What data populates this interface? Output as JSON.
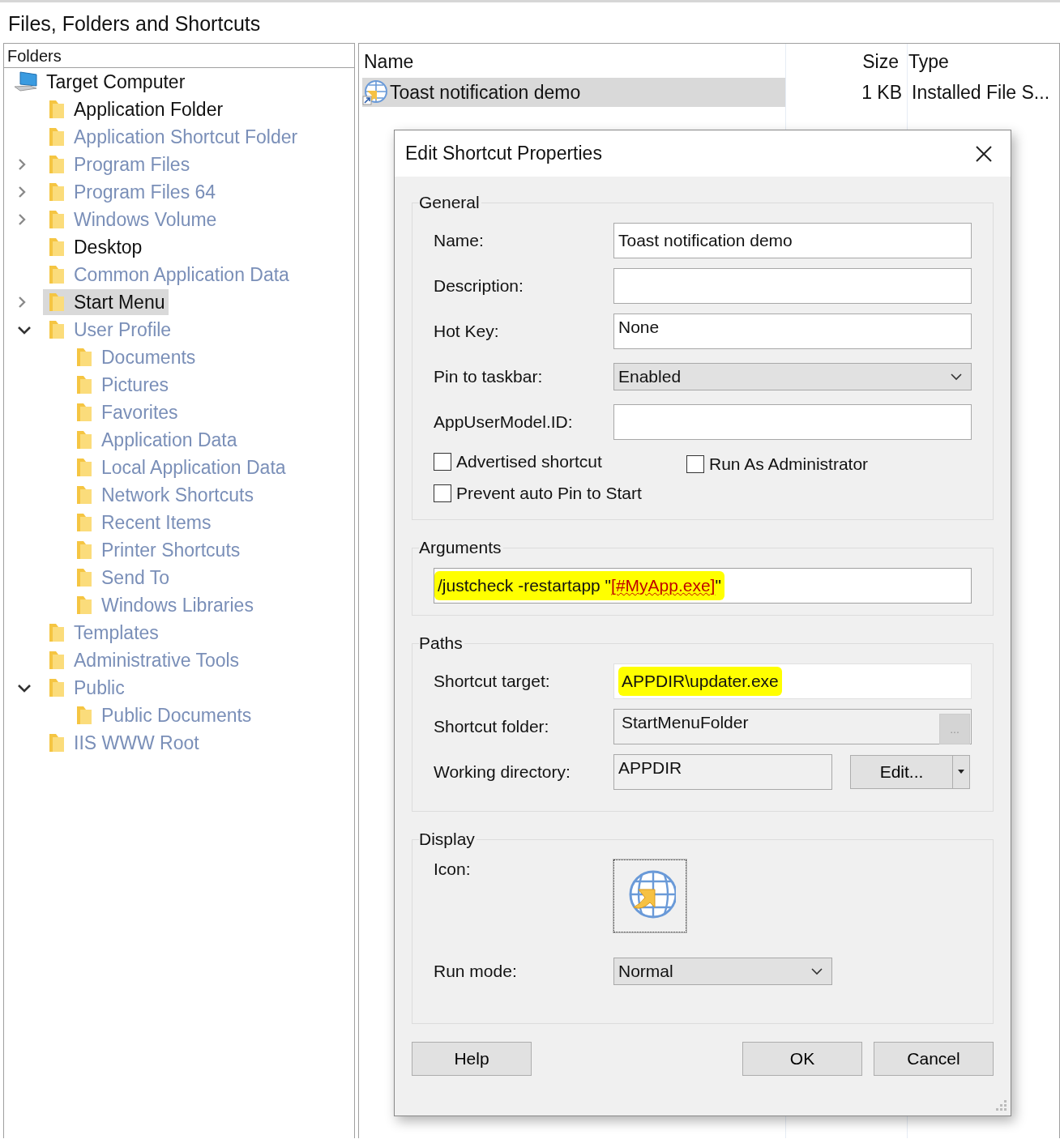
{
  "page": {
    "title": "Files, Folders and Shortcuts"
  },
  "folders_pane": {
    "header": "Folders",
    "tree": [
      {
        "label": "Target Computer",
        "kind": "root",
        "active": true,
        "selected": false,
        "children": [
          {
            "label": "Application Folder",
            "kind": "leaf",
            "active": true,
            "selected": false
          },
          {
            "label": "Application Shortcut Folder",
            "kind": "leaf",
            "active": false,
            "selected": false
          },
          {
            "label": "Program Files",
            "kind": "collapsed",
            "active": false,
            "selected": false
          },
          {
            "label": "Program Files 64",
            "kind": "collapsed",
            "active": false,
            "selected": false
          },
          {
            "label": "Windows Volume",
            "kind": "collapsed",
            "active": false,
            "selected": false
          },
          {
            "label": "Desktop",
            "kind": "leaf",
            "active": true,
            "selected": false
          },
          {
            "label": "Common Application Data",
            "kind": "leaf",
            "active": false,
            "selected": false
          },
          {
            "label": "Start Menu",
            "kind": "collapsed",
            "active": true,
            "selected": true
          },
          {
            "label": "User Profile",
            "kind": "expanded",
            "active": false,
            "selected": false,
            "children": [
              {
                "label": "Documents",
                "kind": "leaf",
                "active": false,
                "selected": false
              },
              {
                "label": "Pictures",
                "kind": "leaf",
                "active": false,
                "selected": false
              },
              {
                "label": "Favorites",
                "kind": "leaf",
                "active": false,
                "selected": false
              },
              {
                "label": "Application Data",
                "kind": "leaf",
                "active": false,
                "selected": false
              },
              {
                "label": "Local Application Data",
                "kind": "leaf",
                "active": false,
                "selected": false
              },
              {
                "label": "Network Shortcuts",
                "kind": "leaf",
                "active": false,
                "selected": false
              },
              {
                "label": "Recent Items",
                "kind": "leaf",
                "active": false,
                "selected": false
              },
              {
                "label": "Printer Shortcuts",
                "kind": "leaf",
                "active": false,
                "selected": false
              },
              {
                "label": "Send To",
                "kind": "leaf",
                "active": false,
                "selected": false
              },
              {
                "label": "Windows Libraries",
                "kind": "leaf",
                "active": false,
                "selected": false
              }
            ]
          },
          {
            "label": "Templates",
            "kind": "leaf",
            "active": false,
            "selected": false
          },
          {
            "label": "Administrative Tools",
            "kind": "leaf",
            "active": false,
            "selected": false
          },
          {
            "label": "Public",
            "kind": "expanded",
            "active": false,
            "selected": false,
            "children": [
              {
                "label": "Public Documents",
                "kind": "leaf",
                "active": false,
                "selected": false
              }
            ]
          },
          {
            "label": "IIS WWW Root",
            "kind": "leaf",
            "active": false,
            "selected": false
          }
        ]
      }
    ]
  },
  "files_pane": {
    "columns": [
      "Name",
      "Size",
      "Type"
    ],
    "rows": [
      {
        "name": "Toast notification demo",
        "size": "1 KB",
        "type": "Installed File S...",
        "selected": true
      }
    ]
  },
  "dialog": {
    "title": "Edit Shortcut Properties",
    "general": {
      "title": "General",
      "fields": [
        {
          "label": "Name:",
          "kind": "text",
          "value": "Toast notification demo"
        },
        {
          "label": "Description:",
          "kind": "text"
        },
        {
          "label": "Hot Key:",
          "kind": "hotkey",
          "value": "None"
        },
        {
          "label": "Pin to taskbar:",
          "kind": "dropdown",
          "value": "Enabled"
        },
        {
          "label": "AppUserModel.ID:",
          "kind": "text"
        }
      ],
      "checkboxes": [
        {
          "label": "Advertised shortcut",
          "checked": false
        },
        {
          "label": "Run As Administrator",
          "checked": false
        },
        {
          "label": "Prevent auto Pin to Start",
          "checked": false
        }
      ]
    },
    "arguments": {
      "title": "Arguments",
      "highlighted": true,
      "segments": [
        {
          "text": "/justcheck -restartapp \"",
          "kind": "plain"
        },
        {
          "text": "[#MyApp.exe]",
          "kind": "reference"
        },
        {
          "text": "\"",
          "kind": "plain"
        }
      ]
    },
    "paths": {
      "title": "Paths",
      "target": {
        "label": "Shortcut target:",
        "value": "APPDIR\\updater.exe",
        "highlighted": true
      },
      "folder": {
        "label": "Shortcut folder:",
        "value": "StartMenuFolder",
        "browse": "..."
      },
      "working": {
        "label": "Working directory:",
        "value": "APPDIR",
        "button": "Edit..."
      }
    },
    "display": {
      "title": "Display",
      "icon_label": "Icon:",
      "run_mode": {
        "label": "Run mode:",
        "value": "Normal"
      }
    },
    "buttons": {
      "help": "Help",
      "ok": "OK",
      "cancel": "Cancel"
    }
  }
}
